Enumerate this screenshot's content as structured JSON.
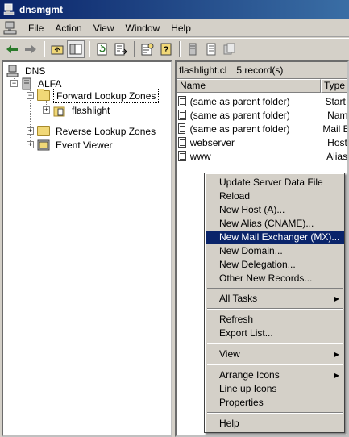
{
  "window": {
    "title": "dnsmgmt"
  },
  "menubar": {
    "items": [
      "File",
      "Action",
      "View",
      "Window",
      "Help"
    ]
  },
  "toolbar": {
    "buttons": [
      "back-arrow-icon",
      "forward-arrow-icon",
      "up-folder-icon",
      "show-hide-tree-icon",
      "refresh-icon",
      "export-list-icon",
      "properties-icon",
      "help-icon",
      "server-icon",
      "list-icon",
      "zone-icon"
    ]
  },
  "tree": {
    "root": "DNS",
    "server": "ALFA",
    "forward_zones": "Forward Lookup Zones",
    "zone": "flashlight",
    "reverse_zones": "Reverse Lookup Zones",
    "event_viewer": "Event Viewer"
  },
  "detail": {
    "header_zone": "flashlight.cl",
    "header_count": "5 record(s)",
    "columns": [
      "Name",
      "Type"
    ],
    "records": [
      {
        "name": "(same as parent folder)",
        "type": "Start o"
      },
      {
        "name": "(same as parent folder)",
        "type": "Name"
      },
      {
        "name": "(same as parent folder)",
        "type": "Mail Ex"
      },
      {
        "name": "webserver",
        "type": "Host ("
      },
      {
        "name": "www",
        "type": "Alias ("
      }
    ]
  },
  "context_menu": {
    "items": [
      "Update Server Data File",
      "Reload",
      "New Host (A)...",
      "New Alias (CNAME)...",
      "New Mail Exchanger (MX)...",
      "New Domain...",
      "New Delegation...",
      "Other New Records...",
      "All Tasks",
      "Refresh",
      "Export List...",
      "View",
      "Arrange Icons",
      "Line up Icons",
      "Properties",
      "Help"
    ],
    "highlighted": "New Mail Exchanger (MX)..."
  },
  "colors": {
    "title_start": "#0a246a",
    "title_end": "#3a6ea5",
    "highlight": "#0a246a",
    "chrome": "#d4d0c8",
    "folder": "#f1d877"
  }
}
